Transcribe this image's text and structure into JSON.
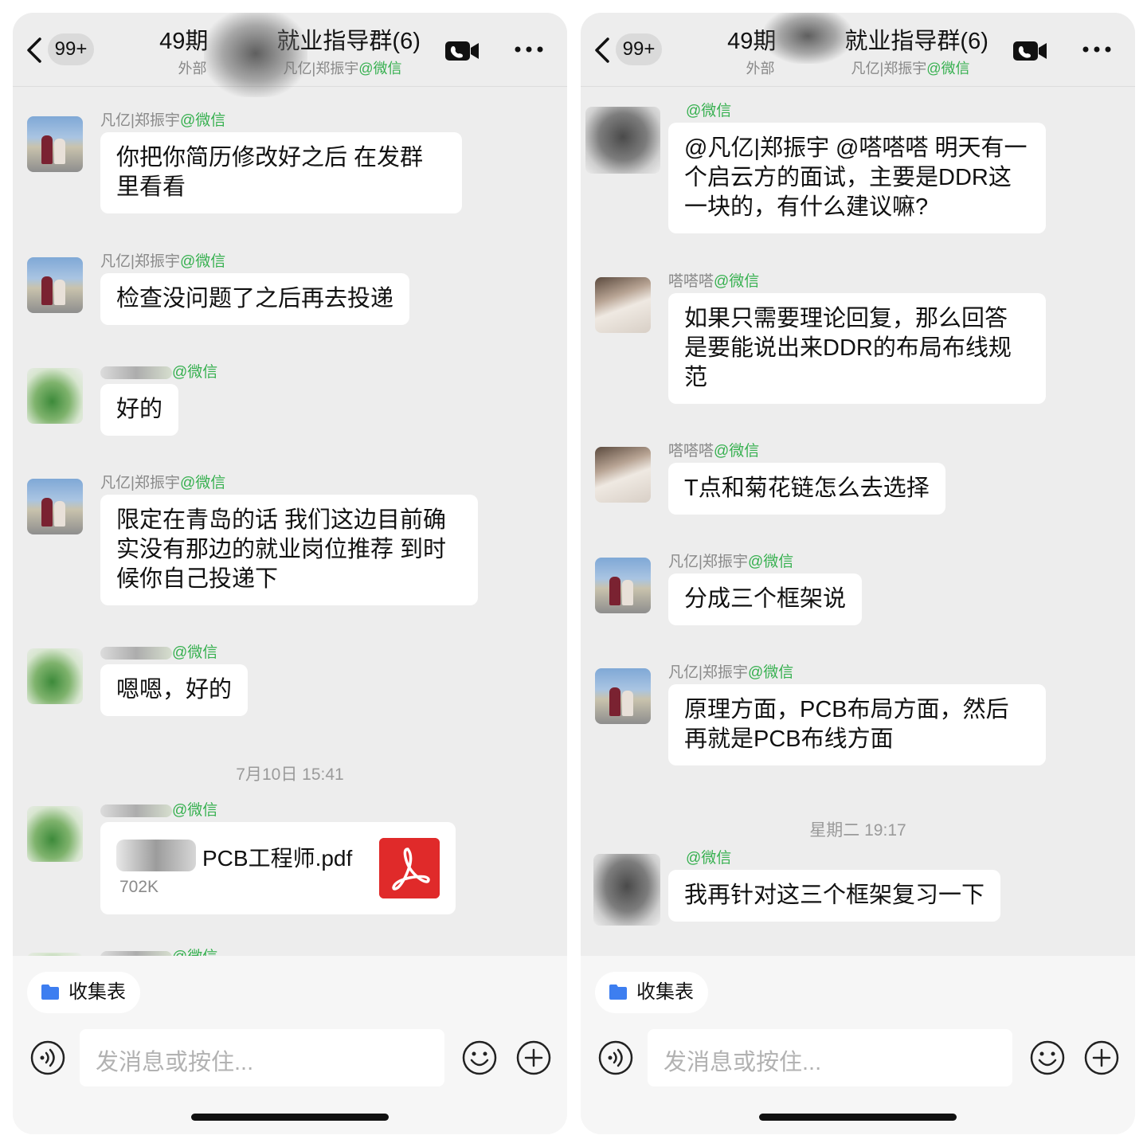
{
  "colors": {
    "wechat_green": "#36b04f",
    "pdf_red": "#e02a2a",
    "chat_bg": "#ededed",
    "bubble_bg": "#ffffff"
  },
  "left": {
    "header": {
      "badge": "99+",
      "title_start": "49期",
      "title_end": "就业指导群(6)",
      "subtitle_start": "外部",
      "subtitle_name": "凡亿|郑振宇",
      "subtitle_wx": "@微信"
    },
    "messages": [
      {
        "sender": "凡亿|郑振宇",
        "wx": "@微信",
        "text": "你把你简历修改好之后 在发群里看看"
      },
      {
        "sender": "凡亿|郑振宇",
        "wx": "@微信",
        "text": "检查没问题了之后再去投递"
      },
      {
        "sender": "",
        "wx": "@微信",
        "text": "好的"
      },
      {
        "sender": "凡亿|郑振宇",
        "wx": "@微信",
        "text": "限定在青岛的话 我们这边目前确实没有那边的就业岗位推荐 到时候你自己投递下"
      },
      {
        "sender": "",
        "wx": "@微信",
        "text": "嗯嗯，好的"
      }
    ],
    "timestamp": "7月10日 15:41",
    "file_message": {
      "sender": "",
      "wx": "@微信",
      "file_name": "PCB工程师.pdf",
      "file_size": "702K"
    },
    "last_sender": {
      "sender": "",
      "wx": "@微信"
    },
    "chip_label": "收集表",
    "input_placeholder": "发消息或按住..."
  },
  "right": {
    "header": {
      "badge": "99+",
      "title_start": "49期",
      "title_end": "就业指导群(6)",
      "subtitle_start": "外部",
      "subtitle_name": "凡亿|郑振宇",
      "subtitle_wx": "@微信"
    },
    "messages": [
      {
        "sender": "",
        "wx": "@微信",
        "text": "@凡亿|郑振宇 @嗒嗒嗒 明天有一个启云方的面试，主要是DDR这一块的，有什么建议嘛?"
      },
      {
        "sender": "嗒嗒嗒",
        "wx": "@微信",
        "text": "如果只需要理论回复，那么回答是要能说出来DDR的布局布线规范"
      },
      {
        "sender": "嗒嗒嗒",
        "wx": "@微信",
        "text": "T点和菊花链怎么去选择"
      },
      {
        "sender": "凡亿|郑振宇",
        "wx": "@微信",
        "text": "分成三个框架说"
      },
      {
        "sender": "凡亿|郑振宇",
        "wx": "@微信",
        "text": "原理方面，PCB布局方面，然后再就是PCB布线方面"
      },
      {
        "sender": "",
        "wx": "@微信",
        "text": "我再针对这三个框架复习一下"
      }
    ],
    "timestamp": "星期二 19:17",
    "chip_label": "收集表",
    "input_placeholder": "发消息或按住..."
  }
}
